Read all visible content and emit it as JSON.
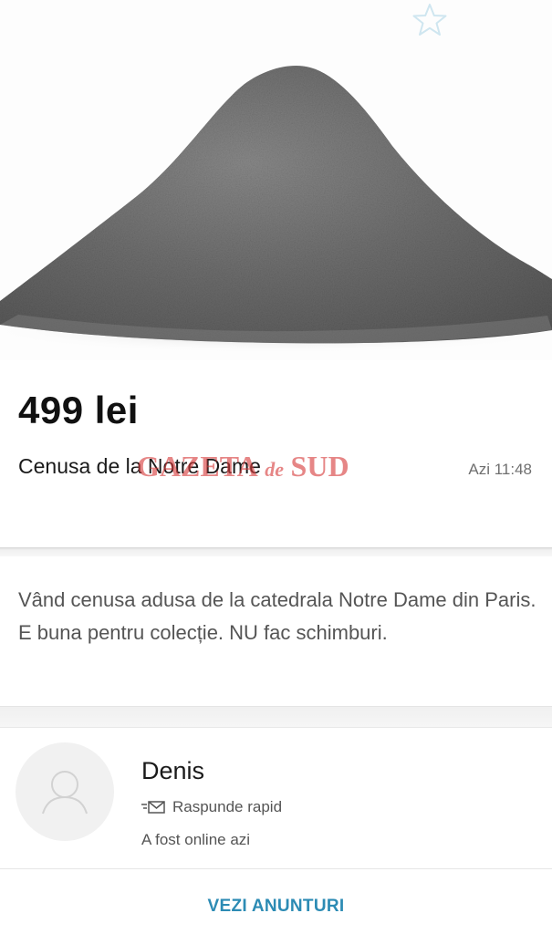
{
  "listing": {
    "price": "499 lei",
    "title": "Cenusa de la Notre Dame",
    "date": "Azi 11:48",
    "description": "Vând cenusa adusa de la catedrala Notre Dame din Paris. E buna pentru colecție. NU fac schimburi."
  },
  "watermark": {
    "part1": "GAZETA",
    "part2": "de",
    "part3": "SUD"
  },
  "seller": {
    "name": "Denis",
    "fast_reply": "Raspunde rapid",
    "last_online": "A fost online azi"
  },
  "actions": {
    "see_ads": "VEZI ANUNTURI"
  },
  "icons": {
    "favorite": "star-outline-icon",
    "fast_reply": "envelope-speed-icon",
    "avatar": "user-placeholder-icon"
  },
  "colors": {
    "accent": "#2c8bb4",
    "star": "#cfe6f0",
    "watermark": "#d63c3c"
  }
}
